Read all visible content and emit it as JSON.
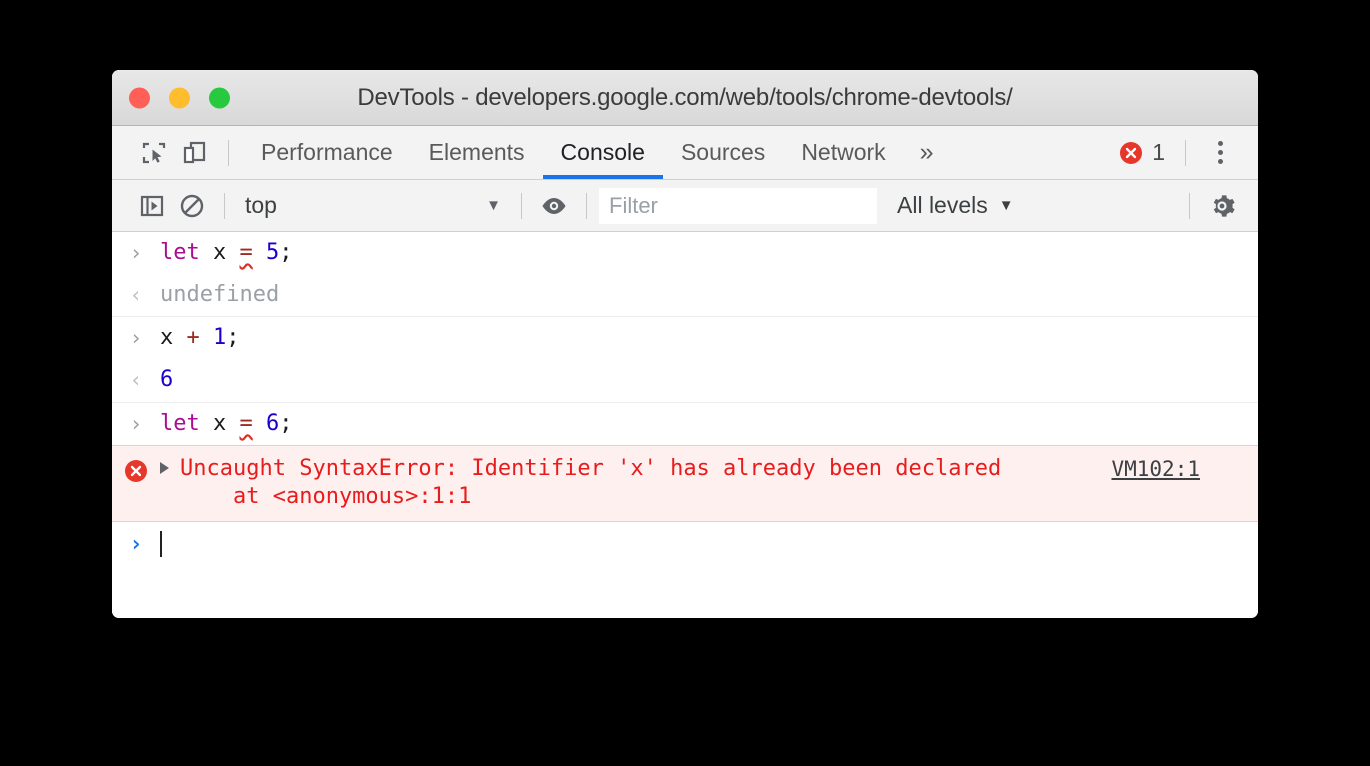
{
  "window": {
    "title": "DevTools - developers.google.com/web/tools/chrome-devtools/",
    "traffic_lights": [
      {
        "name": "close",
        "color": "#ff5f56"
      },
      {
        "name": "minimize",
        "color": "#ffbd2e"
      },
      {
        "name": "zoom",
        "color": "#27c93f"
      }
    ]
  },
  "tabbar": {
    "inspect_icon": "inspect-element-icon",
    "device_icon": "device-toolbar-icon",
    "tabs": [
      {
        "label": "Performance",
        "active": false
      },
      {
        "label": "Elements",
        "active": false
      },
      {
        "label": "Console",
        "active": true
      },
      {
        "label": "Sources",
        "active": false
      },
      {
        "label": "Network",
        "active": false
      }
    ],
    "more_tabs_label": "»",
    "error_count": "1",
    "error_icon": "error-circle-icon",
    "menu_icon": "vertical-dots-icon",
    "active_underline_color": "#1a73e8"
  },
  "console_toolbar": {
    "sidebar_icon": "console-sidebar-toggle-icon",
    "clear_icon": "clear-console-icon",
    "context": {
      "value": "top",
      "caret": "▼"
    },
    "eye_icon": "live-expression-eye-icon",
    "filter": {
      "value": "",
      "placeholder": "Filter"
    },
    "levels": {
      "value": "All levels",
      "caret": "▼"
    },
    "settings_icon": "gear-icon"
  },
  "console": {
    "messages": [
      {
        "kind": "input",
        "marker": "›",
        "tokens": [
          {
            "text": "let",
            "cls": "tok-kw"
          },
          {
            "text": " ",
            "cls": "tok-punc"
          },
          {
            "text": "x",
            "cls": "tok-id"
          },
          {
            "text": " ",
            "cls": "tok-punc"
          },
          {
            "text": "=",
            "cls": "tok-op squiggle"
          },
          {
            "text": " ",
            "cls": "tok-punc"
          },
          {
            "text": "5",
            "cls": "tok-num"
          },
          {
            "text": ";",
            "cls": "tok-punc"
          }
        ],
        "plain": "let x = 5;"
      },
      {
        "kind": "output",
        "marker": "‹",
        "plain": "undefined",
        "cls": "val-undefined"
      },
      {
        "kind": "input",
        "marker": "›",
        "tokens": [
          {
            "text": "x",
            "cls": "tok-id"
          },
          {
            "text": " ",
            "cls": "tok-punc"
          },
          {
            "text": "+",
            "cls": "tok-op"
          },
          {
            "text": " ",
            "cls": "tok-punc"
          },
          {
            "text": "1",
            "cls": "tok-num"
          },
          {
            "text": ";",
            "cls": "tok-punc"
          }
        ],
        "plain": "x + 1;"
      },
      {
        "kind": "output",
        "marker": "‹",
        "plain": "6",
        "cls": "tok-num"
      },
      {
        "kind": "input",
        "marker": "›",
        "tokens": [
          {
            "text": "let",
            "cls": "tok-kw"
          },
          {
            "text": " ",
            "cls": "tok-punc"
          },
          {
            "text": "x",
            "cls": "tok-id"
          },
          {
            "text": " ",
            "cls": "tok-punc"
          },
          {
            "text": "=",
            "cls": "tok-op squiggle"
          },
          {
            "text": " ",
            "cls": "tok-punc"
          },
          {
            "text": "6",
            "cls": "tok-num"
          },
          {
            "text": ";",
            "cls": "tok-punc"
          }
        ],
        "plain": "let x = 6;"
      }
    ],
    "error": {
      "line1": "Uncaught SyntaxError: Identifier 'x' has already been declared",
      "line2": "    at <anonymous>:1:1",
      "source_link": "VM102:1",
      "background": "#fff0f0",
      "text_color": "#e81c1c"
    },
    "prompt": {
      "marker": "›",
      "value": ""
    }
  }
}
